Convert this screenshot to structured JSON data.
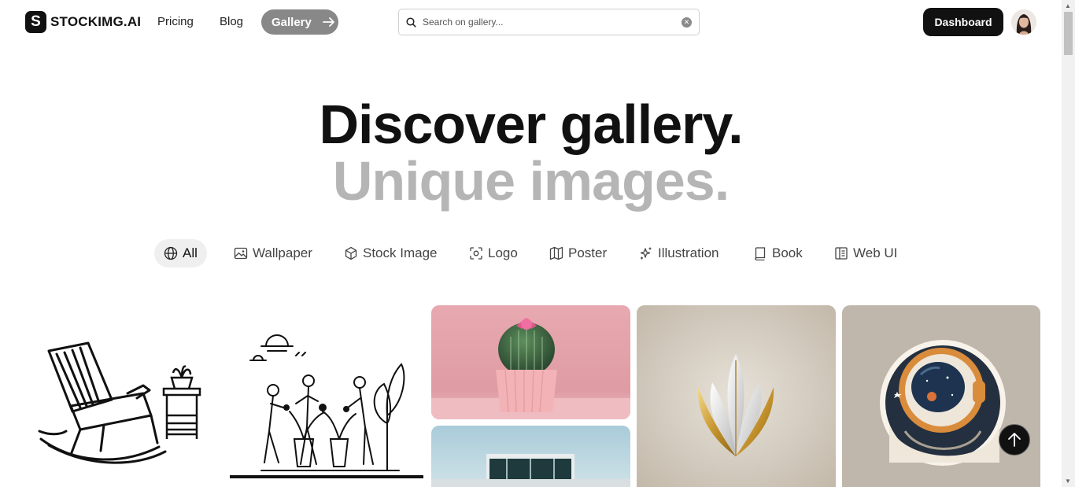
{
  "header": {
    "logo_text": "STOCKIMG.AI",
    "logo_mark": "S",
    "nav": {
      "pricing": "Pricing",
      "blog": "Blog",
      "gallery": "Gallery"
    },
    "search": {
      "placeholder": "Search on gallery..."
    },
    "dashboard": "Dashboard"
  },
  "hero": {
    "line1": "Discover gallery.",
    "line2": "Unique images."
  },
  "categories": [
    {
      "label": "All",
      "icon": "globe-icon",
      "active": true
    },
    {
      "label": "Wallpaper",
      "icon": "image-icon"
    },
    {
      "label": "Stock Image",
      "icon": "cube-icon"
    },
    {
      "label": "Logo",
      "icon": "scan-icon"
    },
    {
      "label": "Poster",
      "icon": "map-icon"
    },
    {
      "label": "Illustration",
      "icon": "sparkles-icon"
    },
    {
      "label": "Book",
      "icon": "book-icon"
    },
    {
      "label": "Web UI",
      "icon": "layout-icon"
    }
  ],
  "colors": {
    "accent": "#111111",
    "muted_text": "#b5b5b5",
    "pill_bg": "#efefef",
    "gallery_btn": "#888888"
  }
}
